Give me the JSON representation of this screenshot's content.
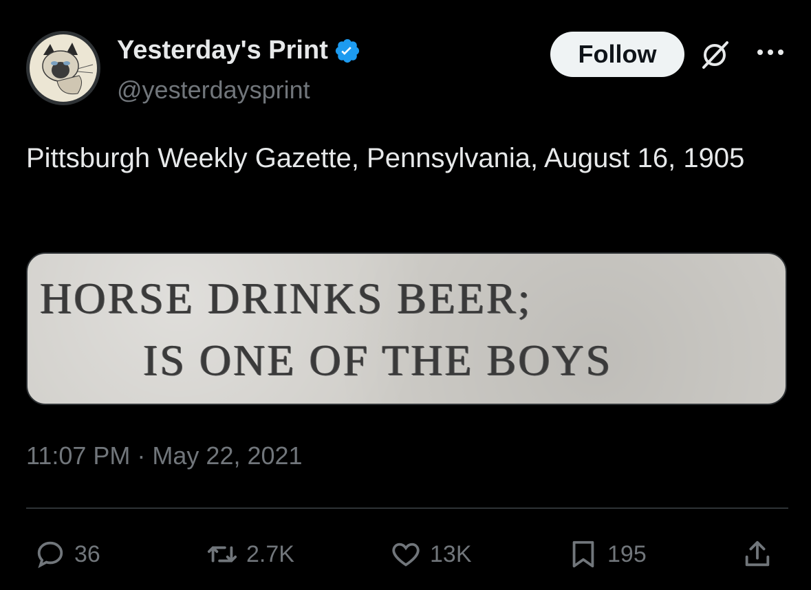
{
  "author": {
    "display_name": "Yesterday's Print",
    "handle": "@yesterdaysprint",
    "verified": true,
    "avatar_icon": "siamese-cat-avatar-icon"
  },
  "header": {
    "follow_label": "Follow",
    "grok_icon": "grok-icon",
    "more_icon": "more-options-icon"
  },
  "tweet": {
    "text": "Pittsburgh Weekly Gazette, Pennsylvania, August 16, 1905",
    "media": {
      "headline_line1": "HORSE DRINKS BEER;",
      "headline_line2": "IS ONE OF THE BOYS"
    },
    "timestamp": "11:07 PM · May 22, 2021"
  },
  "actions": {
    "replies": "36",
    "retweets": "2.7K",
    "likes": "13K",
    "bookmarks": "195"
  },
  "colors": {
    "background": "#000000",
    "text_primary": "#e7e9ea",
    "text_secondary": "#71767b",
    "verified_blue": "#1d9bf0",
    "follow_button_bg": "#eff3f4"
  }
}
